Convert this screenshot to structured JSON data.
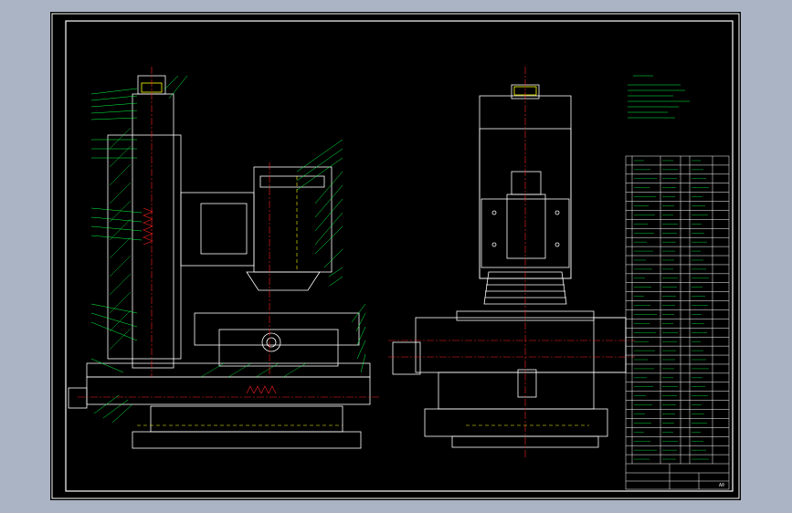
{
  "drawing": {
    "sheet_label": "A0",
    "colors": {
      "background": "#aab4c4",
      "sheet": "#000000",
      "part_line": "#ffffff",
      "leader_line": "#00ff40",
      "center_line": "#ff2020",
      "hidden_line": "#ffff00",
      "hatch": "#00ff40"
    },
    "views": [
      "front-section-view",
      "side-view"
    ],
    "parts_list_rows": 34
  }
}
